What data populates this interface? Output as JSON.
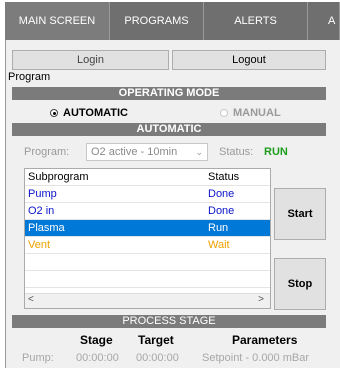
{
  "tabs": [
    {
      "label": "MAIN SCREEN"
    },
    {
      "label": "PROGRAMS"
    },
    {
      "label": "ALERTS"
    },
    {
      "label": "A"
    }
  ],
  "auth": {
    "login_label": "Login",
    "logout_label": "Logout"
  },
  "program_label": "Program",
  "operating_mode": {
    "title": "OPERATING MODE",
    "automatic_label": "AUTOMATIC",
    "manual_label": "MANUAL",
    "selected": "AUTOMATIC"
  },
  "automatic": {
    "title": "AUTOMATIC",
    "program_field_label": "Program:",
    "program_value": "O2 active - 10min",
    "status_label": "Status:",
    "status_value": "RUN"
  },
  "subprogram_table": {
    "headers": [
      "Subprogram",
      "Status"
    ],
    "rows": [
      {
        "name": "Pump",
        "status": "Done"
      },
      {
        "name": "O2 in",
        "status": "Done"
      },
      {
        "name": "Plasma",
        "status": "Run"
      },
      {
        "name": "Vent",
        "status": "Wait"
      }
    ]
  },
  "buttons": {
    "start": "Start",
    "stop": "Stop"
  },
  "process_stage": {
    "title": "PROCESS STAGE",
    "headers": [
      "Stage",
      "Target",
      "Parameters"
    ],
    "row": {
      "name": "Pump:",
      "stage": "00:00:00",
      "target": "00:00:00",
      "parameters": "Setpoint - 0.000 mBar"
    }
  },
  "colors": {
    "status_run": "#1e9e1e",
    "done": "#0a14c8",
    "wait": "#f0a000",
    "selection": "#0078d7",
    "banner": "#7b7b7b"
  }
}
